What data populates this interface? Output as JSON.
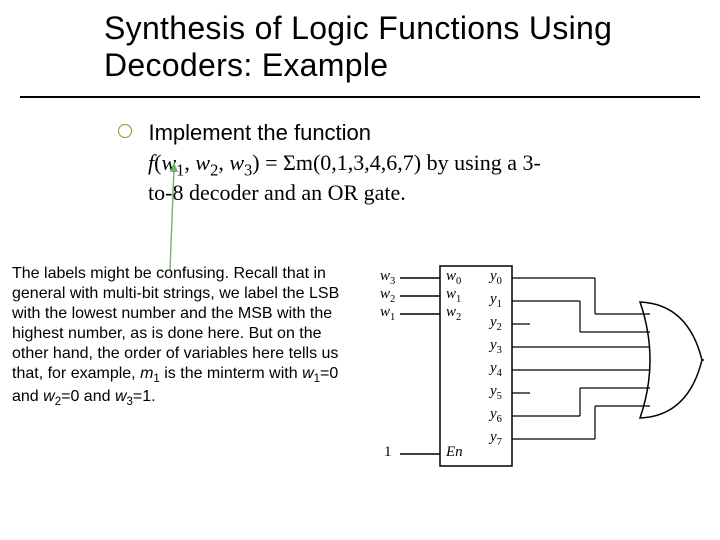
{
  "title": "Synthesis of Logic Functions Using Decoders: Example",
  "bullet": {
    "lead": "Implement the function",
    "fn_name": "f",
    "args": [
      "w",
      "w",
      "w"
    ],
    "arg_subs": [
      "1",
      "2",
      "3"
    ],
    "eq": "=",
    "sigma": "Σm",
    "minterms": "(0,1,3,4,6,7)",
    "tail_a": " by using a 3-",
    "tail_b": "to-8 decoder and an OR gate."
  },
  "note": {
    "p1": "The labels might be confusing. Recall that in general with multi-bit strings, we label the LSB with the lowest number and the MSB with the highest number, as is done here.  But on the other hand, the order of variables here tells us that, for example, ",
    "m1": "m",
    "m1_sub": "1",
    "p2": " is the minterm with ",
    "w1": "w",
    "w1_sub": "1",
    "w1_eq": "=0",
    "and1": " and ",
    "w2": "w",
    "w2_sub": "2",
    "w2_eq": "=0",
    "and2": " and ",
    "w3": "w",
    "w3_sub": "3",
    "w3_eq": "=1",
    "period": "."
  },
  "diagram": {
    "inputs": [
      "w",
      "w",
      "w"
    ],
    "input_subs": [
      "3",
      "2",
      "1"
    ],
    "dec_in": [
      "w",
      "w",
      "w"
    ],
    "dec_in_subs": [
      "0",
      "1",
      "2"
    ],
    "outputs": [
      "y",
      "y",
      "y",
      "y",
      "y",
      "y",
      "y",
      "y"
    ],
    "output_subs": [
      "0",
      "1",
      "2",
      "3",
      "4",
      "5",
      "6",
      "7"
    ],
    "one": "1",
    "en": "En"
  }
}
